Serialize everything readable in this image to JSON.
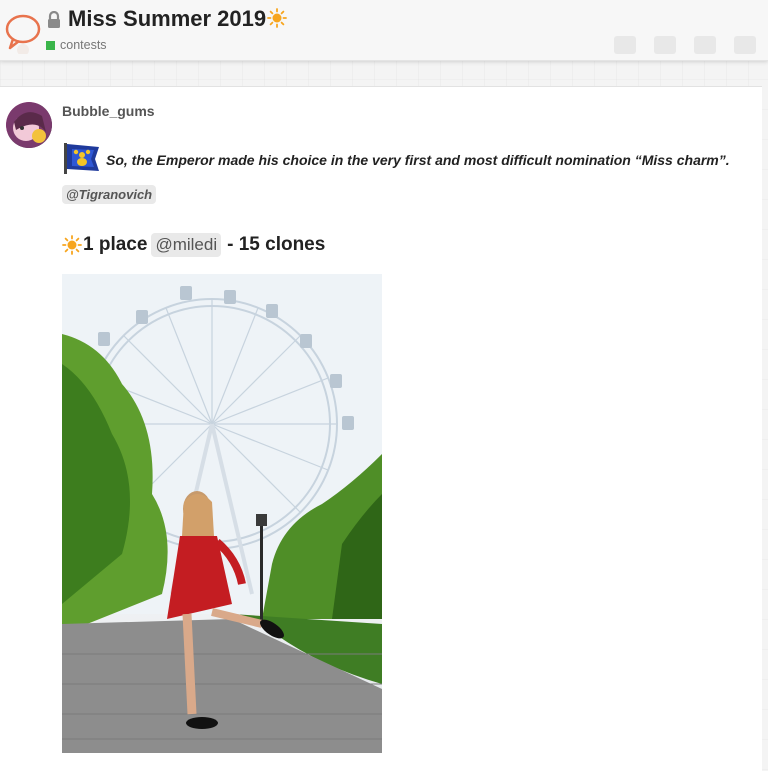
{
  "header": {
    "title": "Miss Summer 2019",
    "category": "contests",
    "category_color": "#3ab54a"
  },
  "post": {
    "username": "Bubble_gums",
    "quote_text": "So, the Emperor made his choice in the very first and most difficult nomination “Miss charm”.",
    "quote_mention": "@Tigranovich",
    "place_label": "1 place",
    "place_mention": "@miledi",
    "place_suffix": "- 15 clones"
  },
  "icons": {
    "logo": "speech-bubble-logo",
    "lock": "lock-icon",
    "sun": "sun-emoji",
    "emperor": "emperor-flag-icon"
  },
  "colors": {
    "accent_logo": "#e8734d",
    "sun": "#f7a51e"
  }
}
